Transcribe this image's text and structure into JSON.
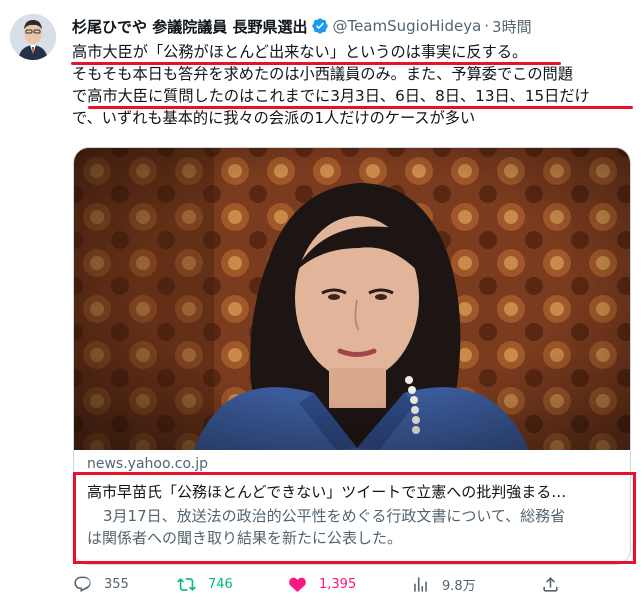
{
  "author": {
    "name": "杉尾ひでや 参議院議員 長野県選出",
    "handle": "@TeamSugioHideya",
    "separator": "·",
    "time": "3時間",
    "avatar_icon": "politician-portrait"
  },
  "tweet": {
    "line1": "高市大臣が「公務がほとんど出来ない」というのは事実に反する。",
    "line2": "そもそも本日も答弁を求めたのは小西議員のみ。また、予算委でこの問題",
    "line3": "で高市大臣に質問したのはこれまでに3月3日、6日、8日、13日、15日だけ",
    "line4": "で、いずれも基本的に我々の会派の1人だけのケースが多い"
  },
  "card": {
    "domain": "news.yahoo.co.jp",
    "title": "高市早苗氏「公務ほとんどできない」ツイートで立憲への批判強まる…",
    "desc_line1": "3月17日、放送法の政治的公平性をめぐる行政文書について、総務省",
    "desc_line2": "は関係者への聞き取り結果を新たに公表した。",
    "image_icon": "woman-portrait-photo"
  },
  "actions": {
    "replies": "355",
    "retweets": "746",
    "likes": "1,395",
    "views": "9.8万"
  },
  "colors": {
    "accent": "#1d9bf0",
    "retweet": "#00ba7c",
    "like": "#f91880",
    "annotation_red": "#e8112d"
  }
}
